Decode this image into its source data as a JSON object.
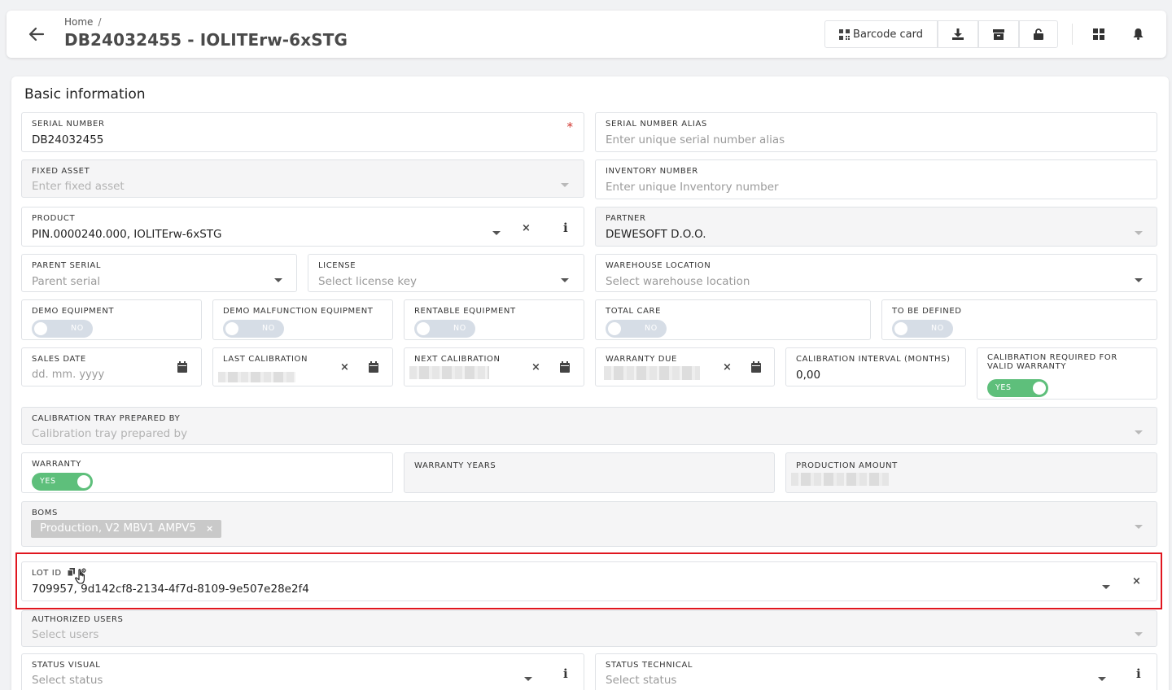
{
  "header": {
    "breadcrumb_home": "Home",
    "breadcrumb_sep": "/",
    "title": "DB24032455 - IOLITErw-6xSTG",
    "barcode_label": "Barcode card"
  },
  "section": {
    "title": "Basic information"
  },
  "fields": {
    "serial_number": {
      "label": "SERIAL NUMBER",
      "value": "DB24032455",
      "required": "*"
    },
    "serial_alias": {
      "label": "SERIAL NUMBER ALIAS",
      "placeholder": "Enter unique serial number alias"
    },
    "fixed_asset": {
      "label": "FIXED ASSET",
      "placeholder": "Enter fixed asset"
    },
    "inventory_number": {
      "label": "INVENTORY NUMBER",
      "placeholder": "Enter unique Inventory number"
    },
    "product": {
      "label": "PRODUCT",
      "value": "PIN.0000240.000, IOLITErw-6xSTG"
    },
    "partner": {
      "label": "PARTNER",
      "value": "DEWESOFT D.O.O."
    },
    "parent_serial": {
      "label": "PARENT SERIAL",
      "placeholder": "Parent serial"
    },
    "license": {
      "label": "LICENSE",
      "placeholder": "Select license key"
    },
    "warehouse_location": {
      "label": "WAREHOUSE LOCATION",
      "placeholder": "Select warehouse location"
    },
    "demo_equipment": {
      "label": "DEMO EQUIPMENT",
      "toggle": "NO"
    },
    "demo_malfunction": {
      "label": "DEMO MALFUNCTION EQUIPMENT",
      "toggle": "NO"
    },
    "rentable_equipment": {
      "label": "RENTABLE EQUIPMENT",
      "toggle": "NO"
    },
    "total_care": {
      "label": "TOTAL CARE",
      "toggle": "NO"
    },
    "to_be_defined": {
      "label": "TO BE DEFINED",
      "toggle": "NO"
    },
    "sales_date": {
      "label": "SALES DATE",
      "placeholder": "dd. mm. yyyy"
    },
    "last_calibration": {
      "label": "LAST CALIBRATION"
    },
    "next_calibration": {
      "label": "NEXT CALIBRATION"
    },
    "warranty_due": {
      "label": "WARRANTY DUE"
    },
    "calibration_interval": {
      "label": "CALIBRATION INTERVAL (MONTHS)",
      "value": "0,00"
    },
    "calibration_required": {
      "label_line1": "CALIBRATION REQUIRED FOR",
      "label_line2": "VALID WARRANTY",
      "toggle": "YES"
    },
    "calibration_tray": {
      "label": "CALIBRATION TRAY PREPARED BY",
      "placeholder": "Calibration tray prepared by"
    },
    "warranty": {
      "label": "WARRANTY",
      "toggle": "YES"
    },
    "warranty_years": {
      "label": "WARRANTY YEARS"
    },
    "production_amount": {
      "label": "PRODUCTION AMOUNT"
    },
    "boms": {
      "label": "BOMS",
      "chip": "Production, V2 MBV1 AMPV5",
      "chip_remove": "×"
    },
    "lot_id": {
      "label": "LOT ID",
      "value": "709957, 9d142cf8-2134-4f7d-8109-9e507e28e2f4"
    },
    "authorized_users": {
      "label": "AUTHORIZED USERS",
      "placeholder": "Select users"
    },
    "status_visual": {
      "label": "STATUS VISUAL",
      "placeholder": "Select status"
    },
    "status_technical": {
      "label": "STATUS TECHNICAL",
      "placeholder": "Select status"
    }
  },
  "glyphs": {
    "clear": "×",
    "info": "i"
  },
  "colors": {
    "toggle_on": "#5ebf7b",
    "toggle_off": "#d6dde6",
    "highlight": "#e0161f",
    "required": "#d0342c"
  }
}
